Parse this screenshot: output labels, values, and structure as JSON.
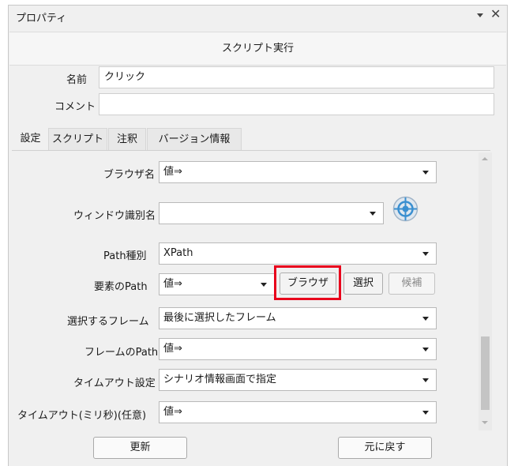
{
  "window": {
    "title": "プロパティ",
    "header": "スクリプト実行"
  },
  "top_fields": {
    "name_label": "名前",
    "name_value": "クリック",
    "comment_label": "コメント",
    "comment_value": ""
  },
  "tabs": [
    {
      "label": "設定",
      "active": true
    },
    {
      "label": "スクリプト",
      "active": false
    },
    {
      "label": "注釈",
      "active": false
    },
    {
      "label": "バージョン情報",
      "active": false
    }
  ],
  "settings": {
    "browser_name": {
      "label": "ブラウザ名",
      "value": "値⇒"
    },
    "window_id": {
      "label": "ウィンドウ識別名",
      "value": ""
    },
    "path_type": {
      "label": "Path種別",
      "value": "XPath"
    },
    "element_path": {
      "label": "要素のPath",
      "value": "値⇒"
    },
    "frame_select": {
      "label": "選択するフレーム",
      "value": "最後に選択したフレーム"
    },
    "frame_path": {
      "label": "フレームのPath",
      "value": "値⇒"
    },
    "timeout_setting": {
      "label": "タイムアウト設定",
      "value": "シナリオ情報画面で指定"
    },
    "timeout_ms": {
      "label": "タイムアウト(ミリ秒)(任意)",
      "value": "値⇒"
    }
  },
  "path_buttons": {
    "browse": "ブラウザ",
    "select": "選択",
    "candidates": "候補"
  },
  "footer": {
    "update": "更新",
    "revert": "元に戻す"
  },
  "colors": {
    "highlight": "#e8001c",
    "target_icon": "#3a8fd0"
  }
}
